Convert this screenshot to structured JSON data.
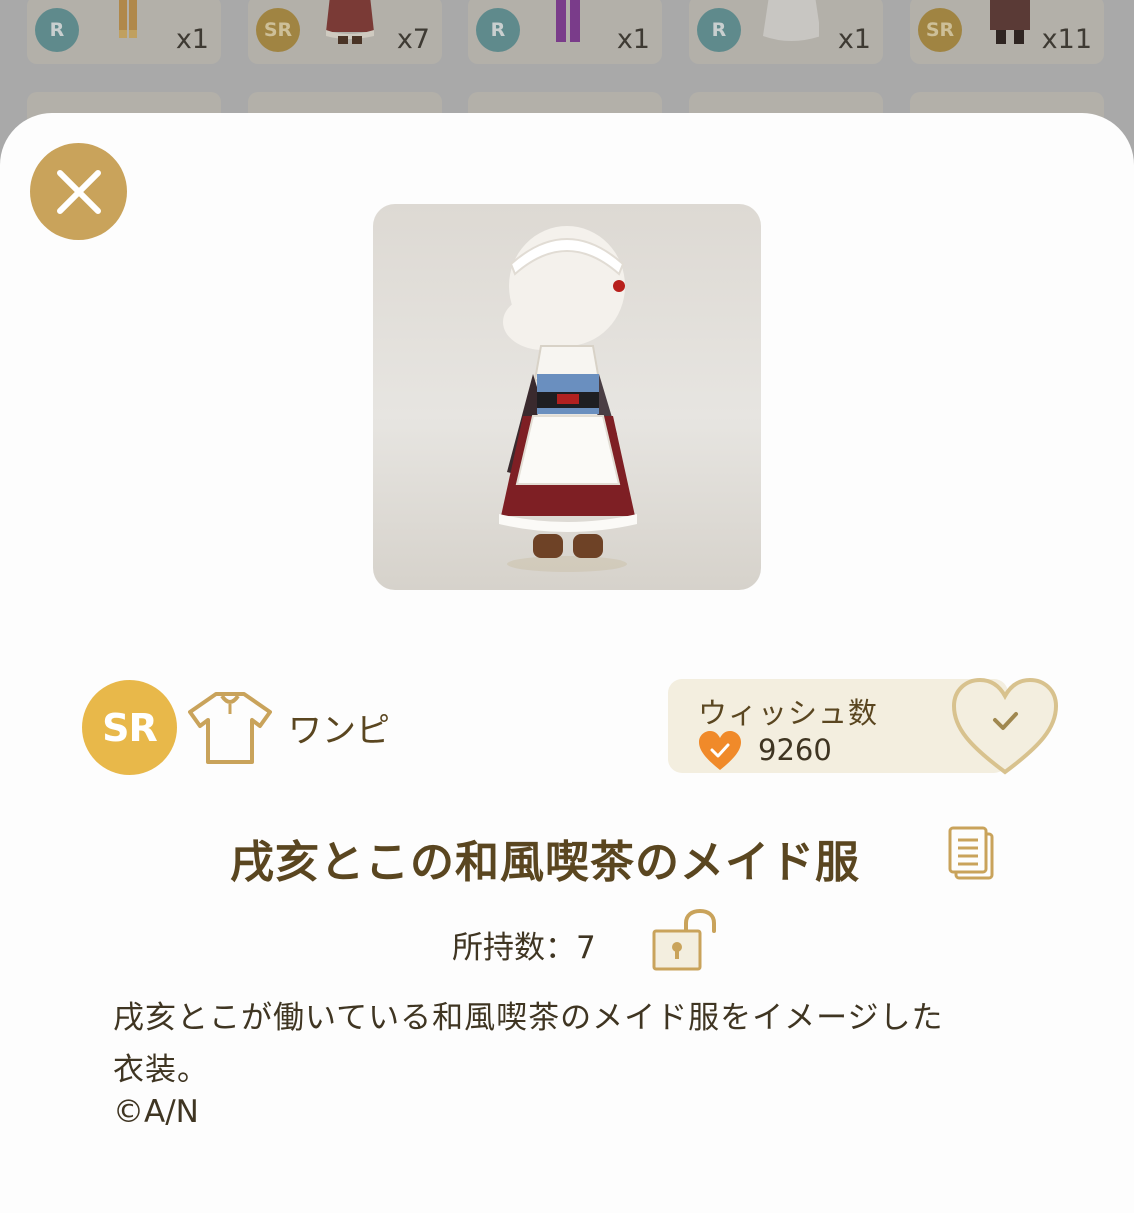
{
  "background_items": [
    {
      "rarity": "R",
      "count": "x1"
    },
    {
      "rarity": "SR",
      "count": "x7"
    },
    {
      "rarity": "R",
      "count": "x1"
    },
    {
      "rarity": "R",
      "count": "x1"
    },
    {
      "rarity": "SR",
      "count": "x11"
    }
  ],
  "detail": {
    "rarity": "SR",
    "category": "ワンピ",
    "wish_label": "ウィッシュ数",
    "wish_count": "9260",
    "item_name": "戌亥とこの和風喫茶のメイド服",
    "owned_label": "所持数：7",
    "description": "戌亥とこが働いている和風喫茶のメイド服をイメージした衣装。",
    "credit": "©A/N"
  },
  "colors": {
    "gold_accent": "#c9a35b",
    "sr_badge": "#e8b84a",
    "text_brown": "#5a4620",
    "wish_heart": "#f08a2a"
  },
  "icons": {
    "close": "close-icon",
    "category": "onepiece-shirt-icon",
    "wish_small": "heart-check-icon",
    "wish_button": "heart-outline-check-icon",
    "copy": "copy-document-icon",
    "lock": "unlocked-padlock-icon"
  }
}
